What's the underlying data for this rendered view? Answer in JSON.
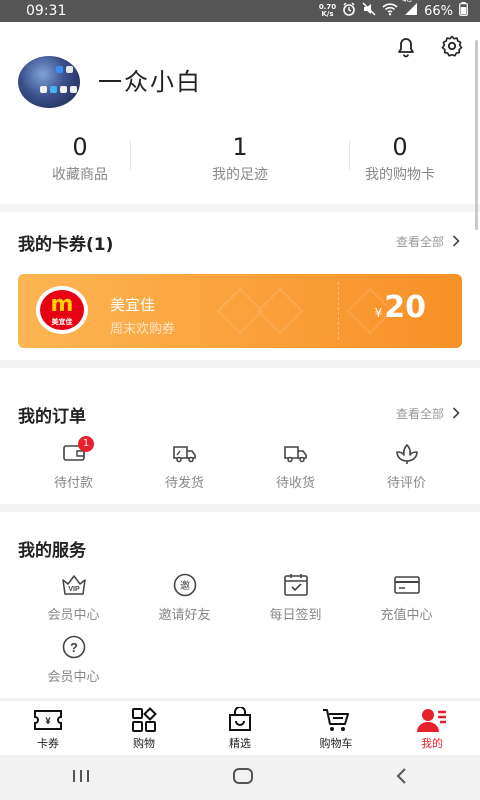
{
  "status_bar": {
    "time": "09:31",
    "speed_value": "0.70",
    "speed_unit": "K/s",
    "battery": "66%",
    "network": "4G"
  },
  "profile": {
    "username": "一众小白",
    "stats": [
      {
        "value": "0",
        "label": "收藏商品"
      },
      {
        "value": "1",
        "label": "我的足迹"
      },
      {
        "value": "0",
        "label": "我的购物卡"
      }
    ]
  },
  "coupons": {
    "title": "我的卡券(1)",
    "view_all": "查看全部",
    "card": {
      "logo_letter": "m",
      "logo_text": "美宜佳",
      "name": "美宜佳",
      "desc": "周末欢购券",
      "currency": "¥",
      "amount": "20"
    }
  },
  "orders": {
    "title": "我的订单",
    "view_all": "查看全部",
    "items": [
      {
        "label": "待付款",
        "icon": "wallet-icon",
        "badge": "1"
      },
      {
        "label": "待发货",
        "icon": "truck-icon"
      },
      {
        "label": "待收货",
        "icon": "delivery-icon"
      },
      {
        "label": "待评价",
        "icon": "flower-icon"
      }
    ]
  },
  "services": {
    "title": "我的服务",
    "items": [
      {
        "label": "会员中心",
        "icon": "vip-crown-icon"
      },
      {
        "label": "邀请好友",
        "icon": "invite-icon"
      },
      {
        "label": "每日签到",
        "icon": "calendar-check-icon"
      },
      {
        "label": "充值中心",
        "icon": "card-icon"
      },
      {
        "label": "会员中心",
        "icon": "question-icon"
      }
    ]
  },
  "tabbar": {
    "items": [
      {
        "label": "卡券",
        "icon": "ticket-icon"
      },
      {
        "label": "购物",
        "icon": "grid-icon"
      },
      {
        "label": "精选",
        "icon": "bag-icon"
      },
      {
        "label": "购物车",
        "icon": "cart-icon"
      },
      {
        "label": "我的",
        "icon": "user-icon",
        "active": true
      }
    ]
  },
  "colors": {
    "accent": "#e8202c",
    "coupon_gradient_start": "#fcb653",
    "coupon_gradient_end": "#f79127"
  }
}
